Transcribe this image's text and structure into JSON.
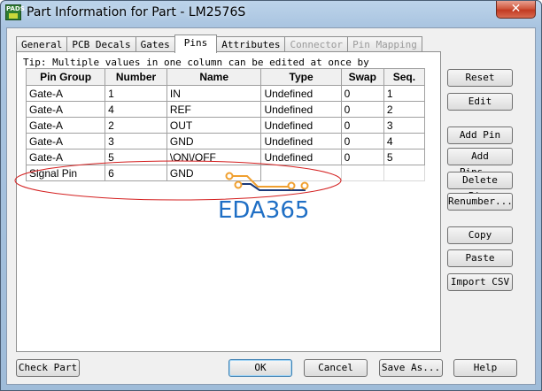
{
  "window": {
    "title": "Part Information for Part - LM2576S",
    "icon_label": "PADS",
    "close_glyph": "✕"
  },
  "tabs": [
    {
      "label": "General",
      "state": "normal"
    },
    {
      "label": "PCB Decals",
      "state": "normal"
    },
    {
      "label": "Gates",
      "state": "normal"
    },
    {
      "label": "Pins",
      "state": "active"
    },
    {
      "label": "Attributes",
      "state": "normal"
    },
    {
      "label": "Connector",
      "state": "disabled"
    },
    {
      "label": "Pin Mapping",
      "state": "disabled"
    }
  ],
  "tip": "Tip: Multiple values in one column can be edited at once by",
  "grid": {
    "columns": [
      "Pin Group",
      "Number",
      "Name",
      "Type",
      "Swap",
      "Seq."
    ],
    "rows": [
      [
        "Gate-A",
        "1",
        "IN",
        "Undefined",
        "0",
        "1"
      ],
      [
        "Gate-A",
        "4",
        "REF",
        "Undefined",
        "0",
        "2"
      ],
      [
        "Gate-A",
        "2",
        "OUT",
        "Undefined",
        "0",
        "3"
      ],
      [
        "Gate-A",
        "3",
        "GND",
        "Undefined",
        "0",
        "4"
      ],
      [
        "Gate-A",
        "5",
        "\\ON\\/OFF",
        "Undefined",
        "0",
        "5"
      ],
      [
        "Signal Pin",
        "6",
        "GND",
        "",
        "",
        ""
      ]
    ]
  },
  "side_buttons": {
    "reset": "Reset",
    "edit": "Edit",
    "add_pin": "Add Pin",
    "add_pins": "Add Pins...",
    "delete_pins": "Delete Pins",
    "renumber": "Renumber...",
    "copy": "Copy",
    "paste": "Paste",
    "import_csv": "Import CSV"
  },
  "bottom_buttons": {
    "check_part": "Check Part",
    "ok": "OK",
    "cancel": "Cancel",
    "save_as": "Save As...",
    "help": "Help"
  },
  "watermark": "EDA365",
  "colors": {
    "annotation_ellipse": "#d42020",
    "watermark_blue": "#1f6fc5",
    "trace_orange": "#f0a030",
    "trace_navy": "#1a3a7a"
  }
}
